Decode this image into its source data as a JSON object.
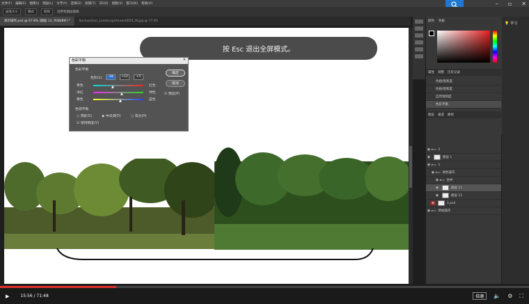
{
  "menu": [
    "文件(F)",
    "编辑(E)",
    "图像(I)",
    "图层(L)",
    "文字(Y)",
    "选择(S)",
    "滤镜(T)",
    "3D(D)",
    "视图(V)",
    "窗口(W)",
    "帮助(H)"
  ],
  "options": {
    "brush_size": "画笔大小",
    "mode": "模式",
    "sample": "取样",
    "all_layers": "对所有图层取样"
  },
  "tabs": [
    "演示操作.psd @ 67.8% (图层 11, RGB/8#) *",
    "SecluesGen_LandscapeGreen0025_M.jpg @ 77.4% (图层 0, RGB/8)"
  ],
  "toast": "按 Esc 退出全屏模式。",
  "dialog": {
    "title": "色彩平衡",
    "section_balance": "色彩平衡",
    "levels_label": "色阶(L):",
    "levels": [
      "-18",
      "+12",
      "+5"
    ],
    "cyan": "青色",
    "red": "红色",
    "magenta": "洋红",
    "green": "绿色",
    "yellow": "黄色",
    "blue": "蓝色",
    "section_tone": "色调平衡",
    "shadows": "阴影(S)",
    "midtones": "中间调(D)",
    "highlights": "高光(H)",
    "preserve": "保持明度(V)",
    "ok": "确定",
    "cancel": "取消",
    "preview": "预览(P)"
  },
  "panels": {
    "color_tab": "颜色",
    "swatches_tab": "色板",
    "history_tabs": [
      "属性",
      "调整",
      "历史记录"
    ],
    "history": [
      "色相/饱和度",
      "色相/饱和度",
      "自然饱和度",
      "色彩平衡"
    ],
    "layers_tabs": [
      "图层",
      "通道",
      "路径"
    ],
    "learn": "学习"
  },
  "layers": [
    "2",
    "图层 1",
    "1",
    "调色操作",
    "合并",
    "图层 11",
    "图层 12",
    "1.psd",
    "原始操作"
  ],
  "player": {
    "time": "15:56 / 71:48",
    "speed": "倍速"
  }
}
